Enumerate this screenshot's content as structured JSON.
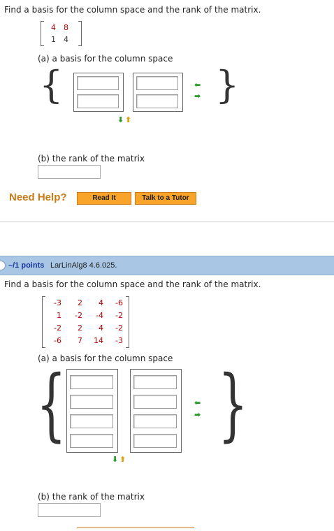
{
  "q1": {
    "prompt": "Find a basis for the column space and the rank of the matrix.",
    "matrix": [
      [
        "4",
        "8"
      ],
      [
        "1",
        "4"
      ]
    ],
    "part_a": "(a) a basis for the column space",
    "part_b": "(b) the rank of the matrix"
  },
  "help": {
    "label": "Need Help?",
    "read_it": "Read It",
    "tutor": "Talk to a Tutor"
  },
  "q2": {
    "points": "–/1 points",
    "code": "LarLinAlg8 4.6.025.",
    "prompt": "Find a basis for the column space and the rank of the matrix.",
    "matrix": [
      [
        "-3",
        "2",
        "4",
        "-6"
      ],
      [
        "1",
        "-2",
        "-4",
        "-2"
      ],
      [
        "-2",
        "2",
        "4",
        "-2"
      ],
      [
        "-6",
        "7",
        "14",
        "-3"
      ]
    ],
    "part_a": "(a) a basis for the column space",
    "part_b": "(b) the rank of the matrix"
  },
  "icons": {
    "add_col": "arrow-right-left",
    "add_row": "arrow-down-up"
  }
}
